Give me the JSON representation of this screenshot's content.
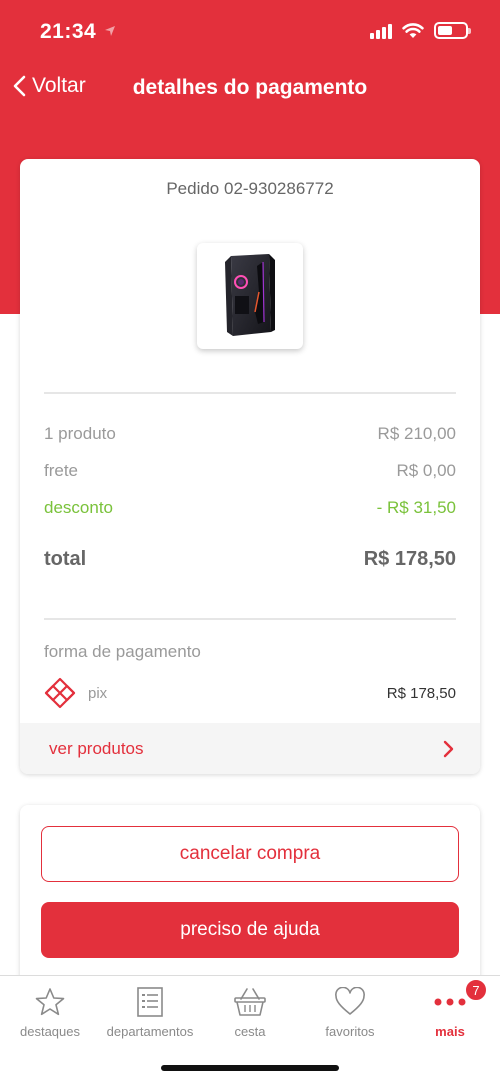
{
  "status_bar": {
    "time": "21:34"
  },
  "nav": {
    "back_label": "Voltar",
    "title": "detalhes do pagamento"
  },
  "order": {
    "title": "Pedido 02-930286772",
    "summary": {
      "products_label": "1 produto",
      "products_value": "R$ 210,00",
      "shipping_label": "frete",
      "shipping_value": "R$ 0,00",
      "discount_label": "desconto",
      "discount_value": "- R$ 31,50",
      "total_label": "total",
      "total_value": "R$ 178,50"
    },
    "payment": {
      "label": "forma de pagamento",
      "method": "pix",
      "amount": "R$ 178,50"
    },
    "view_products_label": "ver produtos"
  },
  "actions": {
    "cancel_label": "cancelar compra",
    "help_label": "preciso de ajuda"
  },
  "tab_bar": {
    "items": [
      {
        "label": "destaques",
        "icon": "star-icon"
      },
      {
        "label": "departamentos",
        "icon": "list-icon"
      },
      {
        "label": "cesta",
        "icon": "basket-icon"
      },
      {
        "label": "favoritos",
        "icon": "heart-icon"
      },
      {
        "label": "mais",
        "icon": "more-dots-icon"
      }
    ],
    "badge_count": "7"
  },
  "colors": {
    "brand": "#e3303c",
    "discount": "#7ac23b"
  }
}
